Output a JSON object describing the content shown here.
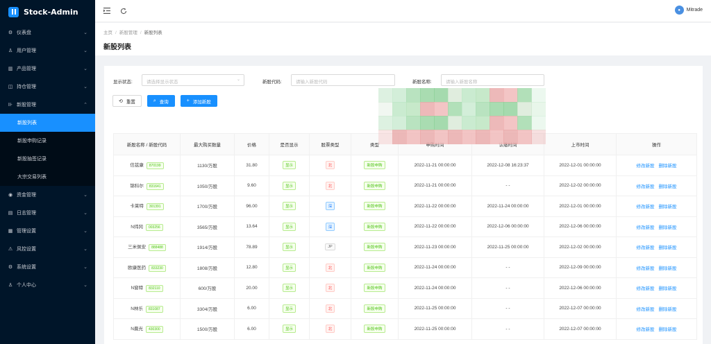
{
  "app": {
    "title": "Stock-Admin"
  },
  "sidebar": {
    "items": [
      {
        "label": "仪表盘",
        "icon": "dashboard-icon",
        "glyph": "⚙"
      },
      {
        "label": "用户管理",
        "icon": "users-icon",
        "glyph": "♙"
      },
      {
        "label": "产品管理",
        "icon": "chart-icon",
        "glyph": "▥"
      },
      {
        "label": "持仓管理",
        "icon": "position-icon",
        "glyph": "◫"
      },
      {
        "label": "新股管理",
        "icon": "ipo-icon",
        "glyph": "⊪",
        "expanded": true
      },
      {
        "label": "资金管理",
        "icon": "money-icon",
        "glyph": "◉"
      },
      {
        "label": "日志管理",
        "icon": "log-icon",
        "glyph": "▤"
      },
      {
        "label": "管理设置",
        "icon": "settings-grid-icon",
        "glyph": "▦"
      },
      {
        "label": "风控设置",
        "icon": "warning-icon",
        "glyph": "⚠"
      },
      {
        "label": "系统设置",
        "icon": "system-icon",
        "glyph": "⚙"
      },
      {
        "label": "个人中心",
        "icon": "person-icon",
        "glyph": "♙"
      }
    ],
    "sub_items": [
      {
        "label": "新股列表",
        "active": true
      },
      {
        "label": "新股申购记录"
      },
      {
        "label": "新股抽签记录"
      },
      {
        "label": "大宗交易列表"
      }
    ]
  },
  "topbar": {
    "user": "Mitrade"
  },
  "breadcrumb": {
    "home": "主页",
    "parent": "新股管理",
    "current": "新股列表"
  },
  "page": {
    "title": "新股列表"
  },
  "filters": {
    "status_label": "显示状态:",
    "status_placeholder": "请选择显示状态",
    "code_label": "新股代码:",
    "code_placeholder": "请输入新股代码",
    "name_label": "新股名称:",
    "name_placeholder": "请输入新股名称"
  },
  "buttons": {
    "reset": "重置",
    "search": "查询",
    "add": "添加新股"
  },
  "table": {
    "headers": [
      "新股名称 / 新股代码",
      "最大购买数量",
      "价格",
      "是否显示",
      "股票类型",
      "类型",
      "申购时间",
      "认缴时间",
      "上市时间",
      "操作"
    ],
    "rows": [
      {
        "name": "信兹康",
        "code": "870199",
        "qty": "1130/万股",
        "price": "31.80",
        "show": "显示",
        "stype": "北",
        "stype_color": "red",
        "type": "新股申购",
        "apply": "2022-11-21 00:00:00",
        "pay": "2022-12-08 16:23:37",
        "list": "2022-12-01 00:00:00",
        "edit": "修改新股",
        "del": "删除新股"
      },
      {
        "name": "锦科尔",
        "code": "831641",
        "qty": "1050/万股",
        "price": "9.60",
        "show": "显示",
        "stype": "北",
        "stype_color": "red",
        "type": "新股申购",
        "apply": "2022-11-21 00:00:00",
        "pay": "- -",
        "list": "2022-12-02 00:00:00",
        "edit": "修改新股",
        "del": "删除新股"
      },
      {
        "name": "卡莱特",
        "code": "301391",
        "qty": "1700/万股",
        "price": "96.00",
        "show": "显示",
        "stype": "深",
        "stype_color": "blue",
        "type": "新股申购",
        "apply": "2022-11-22 00:00:00",
        "pay": "2022-11-24 00:00:00",
        "list": "2022-12-01 00:00:00",
        "edit": "修改新股",
        "del": "删除新股"
      },
      {
        "name": "N纬冈",
        "code": "003256",
        "qty": "3565/万股",
        "price": "13.64",
        "show": "显示",
        "stype": "深",
        "stype_color": "blue",
        "type": "新股申购",
        "apply": "2022-11-22 00:00:00",
        "pay": "2022-12-06 00:00:00",
        "list": "2022-12-06 00:00:00",
        "edit": "修改新股",
        "del": "删除新股"
      },
      {
        "name": "三米佩安",
        "code": "888488",
        "qty": "1914/万股",
        "price": "78.89",
        "show": "显示",
        "stype": "JP",
        "stype_color": "gray",
        "type": "新股申购",
        "apply": "2022-11-23 00:00:00",
        "pay": "2022-11-25 00:00:00",
        "list": "2022-12-02 00:00:00",
        "edit": "修改新股",
        "del": "删除新股"
      },
      {
        "name": "欧康医药",
        "code": "833230",
        "qty": "1808/万股",
        "price": "12.80",
        "show": "显示",
        "stype": "北",
        "stype_color": "red",
        "type": "新股申购",
        "apply": "2022-11-24 00:00:00",
        "pay": "- -",
        "list": "2022-12-09 00:00:00",
        "edit": "修改新股",
        "del": "删除新股"
      },
      {
        "name": "N窗特",
        "code": "832110",
        "qty": "600/万股",
        "price": "20.00",
        "show": "显示",
        "stype": "北",
        "stype_color": "red",
        "type": "新股申购",
        "apply": "2022-11-24 00:00:00",
        "pay": "- -",
        "list": "2022-12-06 00:00:00",
        "edit": "修改新股",
        "del": "删除新股"
      },
      {
        "name": "N林乐",
        "code": "831087",
        "qty": "3304/万股",
        "price": "6.00",
        "show": "显示",
        "stype": "北",
        "stype_color": "red",
        "type": "新股申购",
        "apply": "2022-11-25 00:00:00",
        "pay": "- -",
        "list": "2022-12-07 00:00:00",
        "edit": "修改新股",
        "del": "删除新股"
      },
      {
        "name": "N晨光",
        "code": "430300",
        "qty": "1500/万股",
        "price": "6.00",
        "show": "显示",
        "stype": "北",
        "stype_color": "red",
        "type": "新股申购",
        "apply": "2022-11-25 00:00:00",
        "pay": "- -",
        "list": "2022-12-07 00:00:00",
        "edit": "修改新股",
        "del": "删除新股"
      }
    ]
  },
  "colors": {
    "sidebar_bg": "#001529",
    "accent": "#1890ff",
    "tag_green": "#52c41a",
    "tag_red": "#ff4d4f"
  }
}
